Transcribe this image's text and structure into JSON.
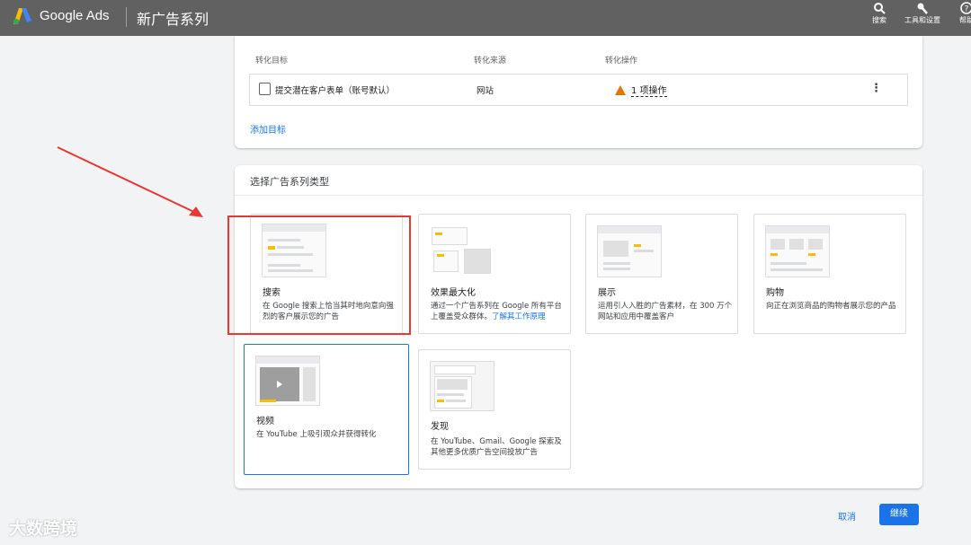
{
  "topbar": {
    "brand": "Google Ads",
    "campaign_title": "新广告系列",
    "tools": [
      {
        "label": "搜索",
        "icon": "search-icon"
      },
      {
        "label": "工具和设置",
        "icon": "wrench-icon"
      },
      {
        "label": "帮助",
        "icon": "help-icon"
      }
    ]
  },
  "goals": {
    "headers": [
      "转化目标",
      "转化来源",
      "转化操作"
    ],
    "row": {
      "name": "提交潜在客户表单（账号默认）",
      "source": "网站",
      "action": "1 项操作",
      "status_icon": "warning-icon"
    },
    "add_goal": "添加目标"
  },
  "campaign_type": {
    "title": "选择广告系列类型",
    "types": [
      {
        "name": "搜索",
        "desc": "在 Google 搜索上恰当其时地向意向强烈的客户展示您的广告"
      },
      {
        "name": "效果最大化",
        "desc": "通过一个广告系列在 Google 所有平台上覆盖受众群体。",
        "link": "了解其工作原理"
      },
      {
        "name": "展示",
        "desc": "运用引人入胜的广告素材，在 300 万个网站和应用中覆盖客户"
      },
      {
        "name": "购物",
        "desc": "向正在浏览商品的购物者展示您的产品"
      },
      {
        "name": "视频",
        "desc": "在 YouTube 上吸引观众并获得转化"
      },
      {
        "name": "发现",
        "desc": "在 YouTube、Gmail、Google 探索及其他更多优质广告空间投放广告"
      }
    ]
  },
  "footer": {
    "cancel": "取消",
    "continue": "继续"
  },
  "watermark": "大数跨境",
  "colors": {
    "accent": "#1a73e8",
    "topbar": "#616161",
    "highlight": "#e53935",
    "warning": "#e37400",
    "thumb_accent": "#fbbc04"
  }
}
